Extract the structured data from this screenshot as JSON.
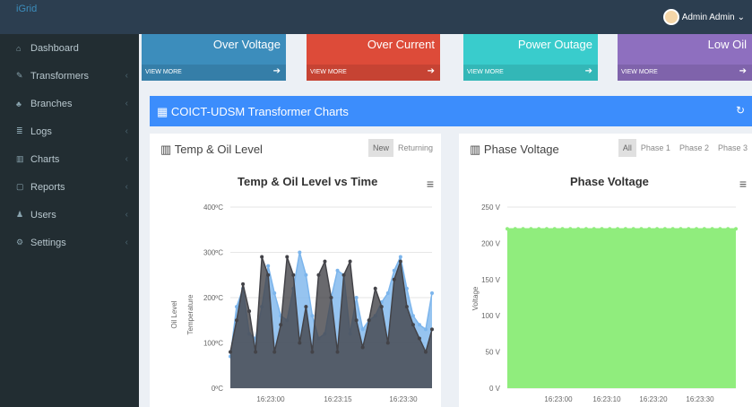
{
  "app": {
    "brand": "iGrid",
    "user": "Admin Admin"
  },
  "sidebar": {
    "items": [
      {
        "label": "Dashboard",
        "icon": "home-icon"
      },
      {
        "label": "Transformers",
        "icon": "transformer-icon"
      },
      {
        "label": "Branches",
        "icon": "branches-icon"
      },
      {
        "label": "Logs",
        "icon": "logs-icon"
      },
      {
        "label": "Charts",
        "icon": "charts-icon"
      },
      {
        "label": "Reports",
        "icon": "reports-icon"
      },
      {
        "label": "Users",
        "icon": "users-icon"
      },
      {
        "label": "Settings",
        "icon": "settings-icon"
      }
    ]
  },
  "boxes": [
    {
      "title": "Over Voltage",
      "more": "VIEW MORE",
      "color": "#3c8dbc"
    },
    {
      "title": "Over Current",
      "more": "VIEW MORE",
      "color": "#dd4b39"
    },
    {
      "title": "Power Outage",
      "more": "VIEW MORE",
      "color": "#39cccc"
    },
    {
      "title": "Low Oil",
      "more": "VIEW MORE",
      "color": "#8e6fbf"
    }
  ],
  "panel": {
    "title": "COICT-UDSM Transformer Charts"
  },
  "temp_card": {
    "title": "Temp & Oil Level",
    "tabs": [
      "New",
      "Returning"
    ],
    "chart_title": "Temp & Oil Level vs Time"
  },
  "voltage_card": {
    "title": "Phase Voltage",
    "tabs": [
      "All",
      "Phase 1",
      "Phase 2",
      "Phase 3"
    ],
    "chart_title": "Phase Voltage"
  },
  "chart_data": [
    {
      "type": "area",
      "title": "Temp & Oil Level vs Time",
      "ylabel_primary": "Temperature",
      "ylabel_secondary": "Oil Level",
      "yticks": [
        "0ºC",
        "100ºC",
        "200ºC",
        "300ºC",
        "400ºC"
      ],
      "ylim": [
        0,
        400
      ],
      "xticks": [
        "16:23:00",
        "16:23:15",
        "16:23:30"
      ],
      "series": [
        {
          "color": "#7cb5ec",
          "values": [
            70,
            180,
            220,
            120,
            110,
            180,
            270,
            210,
            160,
            150,
            220,
            300,
            250,
            160,
            110,
            120,
            200,
            260,
            250,
            120,
            200,
            130,
            150,
            160,
            190,
            210,
            260,
            290,
            220,
            160,
            140,
            130,
            210
          ]
        },
        {
          "color": "#434348",
          "values": [
            80,
            150,
            230,
            170,
            80,
            290,
            250,
            80,
            140,
            290,
            250,
            100,
            180,
            80,
            250,
            280,
            200,
            80,
            250,
            280,
            150,
            90,
            150,
            220,
            180,
            100,
            240,
            280,
            180,
            140,
            110,
            80,
            130
          ]
        }
      ]
    },
    {
      "type": "area",
      "title": "Phase Voltage",
      "ylabel": "Voltage",
      "yticks": [
        "0 V",
        "50 V",
        "100 V",
        "150 V",
        "200 V",
        "250 V"
      ],
      "ylim": [
        0,
        250
      ],
      "xticks": [
        "16:23:00",
        "16:23:10",
        "16:23:20",
        "16:23:30"
      ],
      "series": [
        {
          "color": "#90ed7d",
          "values": [
            220,
            220,
            220,
            220,
            220,
            220,
            220,
            220,
            220,
            220,
            220,
            220,
            220,
            220,
            220,
            220,
            220,
            220,
            220,
            220,
            220,
            220,
            220,
            220,
            220,
            220,
            220,
            220,
            220,
            220
          ]
        }
      ]
    }
  ]
}
